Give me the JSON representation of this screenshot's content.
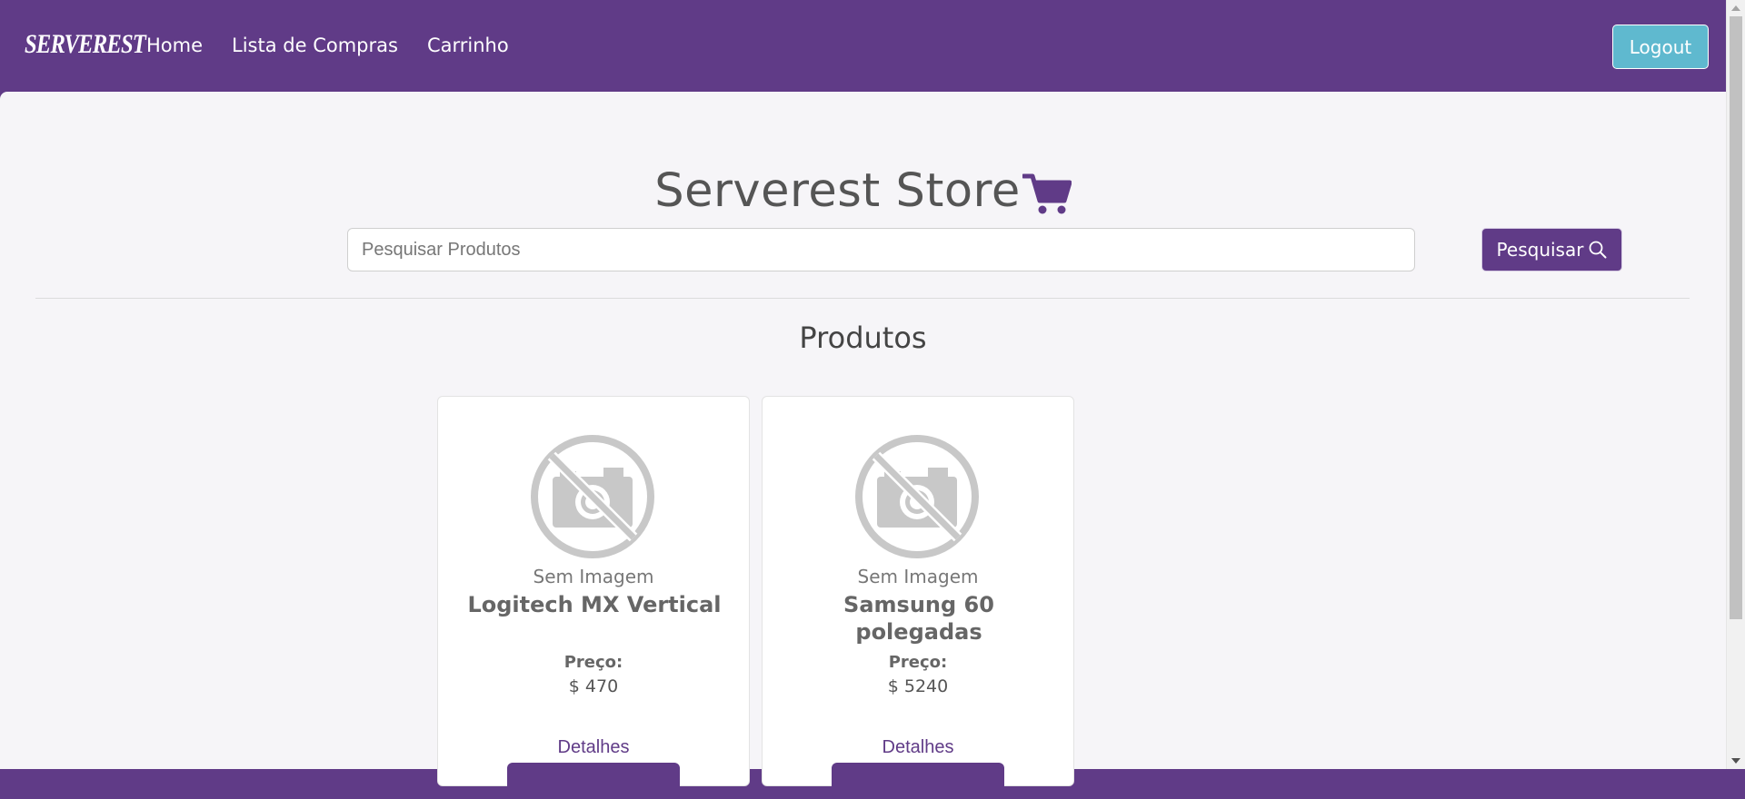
{
  "navbar": {
    "logo_text": "SERVEREST",
    "links": [
      "Home",
      "Lista de Compras",
      "Carrinho"
    ],
    "logout_label": "Logout"
  },
  "main": {
    "title": "Serverest Store",
    "title_icon": "shopping-cart-icon",
    "search": {
      "placeholder": "Pesquisar Produtos",
      "value": "",
      "button_label": "Pesquisar",
      "button_icon": "search-icon"
    },
    "section_title": "Produtos",
    "products": [
      {
        "image_caption": "Sem Imagem",
        "name": "Logitech MX Vertical",
        "price_label": "Preço:",
        "price": "$ 470",
        "details_label": "Detalhes"
      },
      {
        "image_caption": "Sem Imagem",
        "name": "Samsung 60 polegadas",
        "price_label": "Preço:",
        "price": "$ 5240",
        "details_label": "Detalhes"
      }
    ]
  },
  "colors": {
    "brand": "#603b87",
    "logout": "#5fb9cf",
    "background": "#f6f5f8",
    "placeholder_gray": "#c8c8c8"
  }
}
